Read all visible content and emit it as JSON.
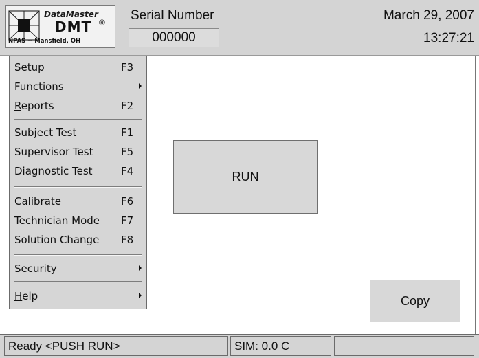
{
  "header": {
    "logo": {
      "line1": "DataMaster",
      "line2": "DMT",
      "registered": "®",
      "line3": "NPAS -- Mansfield, OH"
    },
    "serial_label": "Serial Number",
    "serial_value": "000000",
    "date": "March 29, 2007",
    "time": "13:27:21"
  },
  "menu": {
    "items": [
      {
        "label": "Setup",
        "key": "F3",
        "submenu": false
      },
      {
        "label": "Functions",
        "key": "",
        "submenu": true
      },
      {
        "label_first": "R",
        "label_rest": "eports",
        "key": "F2",
        "submenu": false
      },
      {
        "label": "Subject Test",
        "key": "F1",
        "submenu": false
      },
      {
        "label": "Supervisor Test",
        "key": "F5",
        "submenu": false
      },
      {
        "label": "Diagnostic Test",
        "key": "F4",
        "submenu": false
      },
      {
        "label": "Calibrate",
        "key": "F6",
        "submenu": false
      },
      {
        "label": "Technician Mode",
        "key": "F7",
        "submenu": false
      },
      {
        "label": "Solution Change",
        "key": "F8",
        "submenu": false
      },
      {
        "label": "Security",
        "key": "",
        "submenu": true
      },
      {
        "label_first": "H",
        "label_rest": "elp",
        "key": "",
        "submenu": true
      }
    ]
  },
  "buttons": {
    "run": "RUN",
    "copy": "Copy"
  },
  "status": {
    "message": "Ready  <PUSH RUN>",
    "sim": "SIM: 0.0 C",
    "extra": ""
  }
}
